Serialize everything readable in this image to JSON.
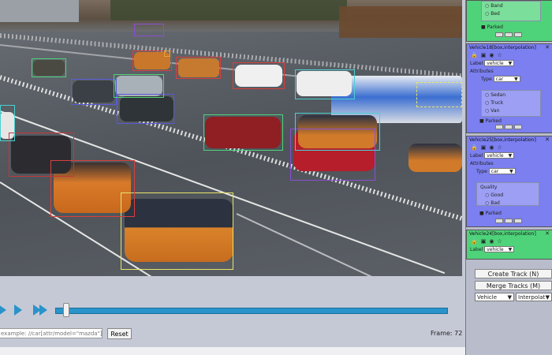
{
  "video": {
    "frame_label": "Frame: 72"
  },
  "filter": {
    "placeholder": "example: //car[attr/model=\"mazda\"]",
    "reset_label": "Reset"
  },
  "panel": {
    "track_top": {
      "options": [
        "Band",
        "Bed"
      ],
      "parked_label": "Parked"
    },
    "track_18": {
      "title": "Vehicle18[box,interpolation]",
      "close": "✕",
      "label_caption": "Label",
      "label_value": "vehicle",
      "attributes_caption": "Attributes",
      "type_caption": "Type",
      "type_value": "car",
      "options": [
        "Sedan",
        "Truck",
        "Van"
      ],
      "parked_label": "Parked"
    },
    "track_25": {
      "title": "Vehicle25[box,interpolation]",
      "close": "✕",
      "label_caption": "Label",
      "label_value": "vehicle",
      "attributes_caption": "Attributes",
      "type_caption": "Type",
      "type_value": "car",
      "quality_caption": "Quality",
      "options": [
        "Good",
        "Bad"
      ],
      "parked_label": "Parked"
    },
    "track_24": {
      "title": "Vehicle24[box,interpolation]",
      "close": "✕",
      "label_caption": "Label",
      "label_value": "vehicle"
    },
    "create_track": "Create Track (N)",
    "merge_tracks": "Merge Tracks (M)",
    "label_select": "Vehicle",
    "mode_select": "Interpolat",
    "colors": {
      "blue": "#7b7ff0",
      "green": "#4fd37a",
      "accent": "#2a93c9"
    }
  }
}
